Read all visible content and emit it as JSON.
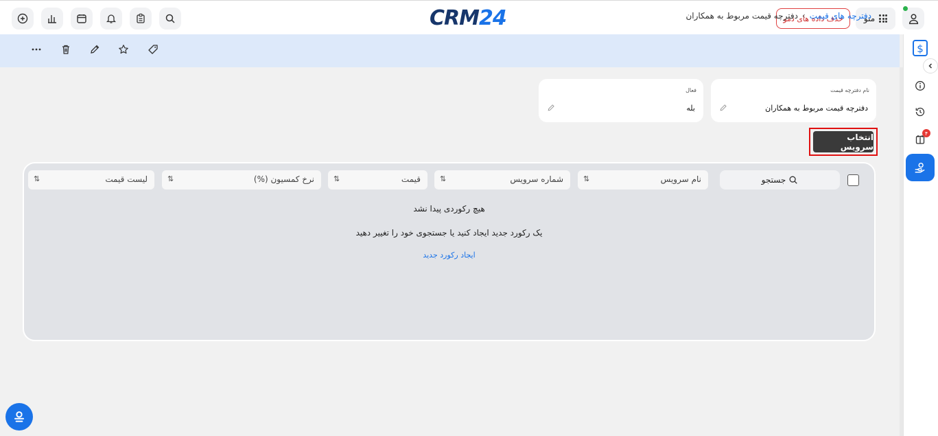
{
  "header": {
    "logo_crm": "CRM",
    "logo_num": "24",
    "demo_button": "حذف داده های دمو",
    "menu_label": "منو",
    "left_icons": [
      "plus-circle-icon",
      "chart-icon",
      "calendar-icon",
      "bell-icon",
      "clipboard-icon",
      "search-icon"
    ]
  },
  "breadcrumb": {
    "parent": "دفترچه های قیمت",
    "separator": "›",
    "current": "دفترچه قیمت مربوط به همکاران"
  },
  "toolbar": {
    "icons": [
      "more-icon",
      "trash-icon",
      "pencil-icon",
      "star-icon",
      "tag-icon"
    ]
  },
  "fields": {
    "name_label": "نام دفترچه قیمت",
    "name_value": "دفترچه قیمت مربوط به همکاران",
    "active_label": "فعال",
    "active_value": "بله"
  },
  "select_service": "انتخاب سرویس",
  "table": {
    "search_label": "جستجو",
    "columns": [
      "نام سرویس",
      "شماره سرویس",
      "قیمت",
      "نرخ کمسیون (%)",
      "لیست قیمت"
    ],
    "sort_glyph": "⇅",
    "empty_title": "هیچ رکوردی پیدا نشد",
    "empty_desc": "یک رکورد جدید ایجاد کنید یا جستجوی خود را تغییر دهید",
    "empty_link": "ایجاد رکورد جدید"
  },
  "sidebar": {
    "badge_count": "۴",
    "icons": [
      "info-icon",
      "history-icon",
      "notes-icon",
      "hand-coin-icon"
    ]
  },
  "colors": {
    "accent": "#1a73e8",
    "danger": "#e01010",
    "crumb_bg": "#dde9fa"
  }
}
